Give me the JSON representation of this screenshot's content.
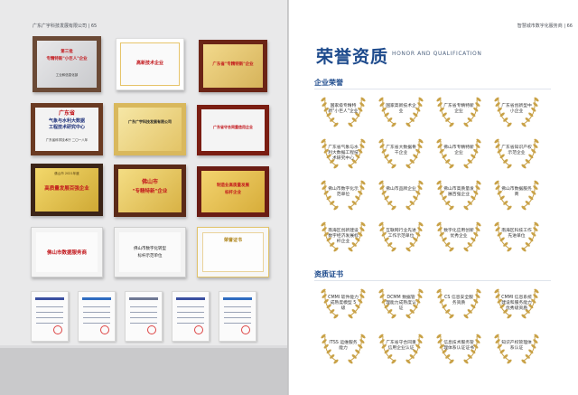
{
  "left_page": {
    "header": "广东广宇科技发展有限公司 | 65",
    "plaques": [
      {
        "lines": [
          "第三批",
          "专精特新\"小巨人\"企业"
        ],
        "small": "工业和信息化部"
      },
      {
        "lines": [
          "高新技术企业"
        ],
        "small": ""
      },
      {
        "lines": [
          "广东省\"专精特新\"企业"
        ],
        "small": ""
      },
      {
        "lines": [
          "广东省",
          "气象与水利大数据",
          "工程技术研究中心"
        ],
        "small": "广东省科学技术厅 二〇一八年"
      },
      {
        "lines": [
          "广东广宇科技发展有限公司"
        ],
        "small": ""
      },
      {
        "lines": [
          "广东省守合同重信用企业"
        ],
        "small": ""
      },
      {
        "lines": [
          "高质量发展百强企业"
        ],
        "small": "佛山市 2021年度"
      },
      {
        "lines": [
          "佛山市",
          "\"专精特新\"企业"
        ],
        "small": ""
      },
      {
        "lines": [
          "制造业高质量发展",
          "标杆企业"
        ],
        "small": ""
      },
      {
        "lines": [
          "佛山市数据服务商"
        ],
        "small": ""
      },
      {
        "lines": [
          "佛山市数字化转型",
          "标杆示范单位"
        ],
        "small": ""
      },
      {
        "lines": [
          "荣誉证书"
        ],
        "small": ""
      }
    ]
  },
  "right_page": {
    "header": "智慧城市数字化服务商 | 66",
    "title_cn": "荣誉资质",
    "title_en": "HONOR AND QUALIFICATION",
    "section_honors": "企业荣誉",
    "honors": [
      "国家级专精特新\"小巨人\"企业",
      "国家高新技术企业",
      "广东省专精特新企业",
      "广东省创新型中小企业",
      "广东省气象与水利大数据工程技术研究中心",
      "广东省大数据骨干企业",
      "佛山市专精特新企业",
      "广东省知识产权示范企业",
      "佛山市数字化示范单位",
      "佛山市品牌企业",
      "佛山市高质量发展百强企业",
      "佛山市数据服务商",
      "南海区创新建设数字经济发展标杆企业",
      "互联网行业先进工作示范单位",
      "数字化应用创新优秀企业",
      "南海区科技工作先进单位"
    ],
    "section_certs": "资质证书",
    "certs": [
      "CMMI 软件能力成熟度模型 5 级",
      "DCMM 数据管理能力成熟度认证",
      "CS 信息安全服务资质",
      "CMMI 信息系统建设和服务能力优秀级资质",
      "ITSS 运维服务能力",
      "广东省守合同重信用企业认证",
      "信息技术服务管理体系认证证书",
      "知识产权管理体系认证"
    ]
  }
}
